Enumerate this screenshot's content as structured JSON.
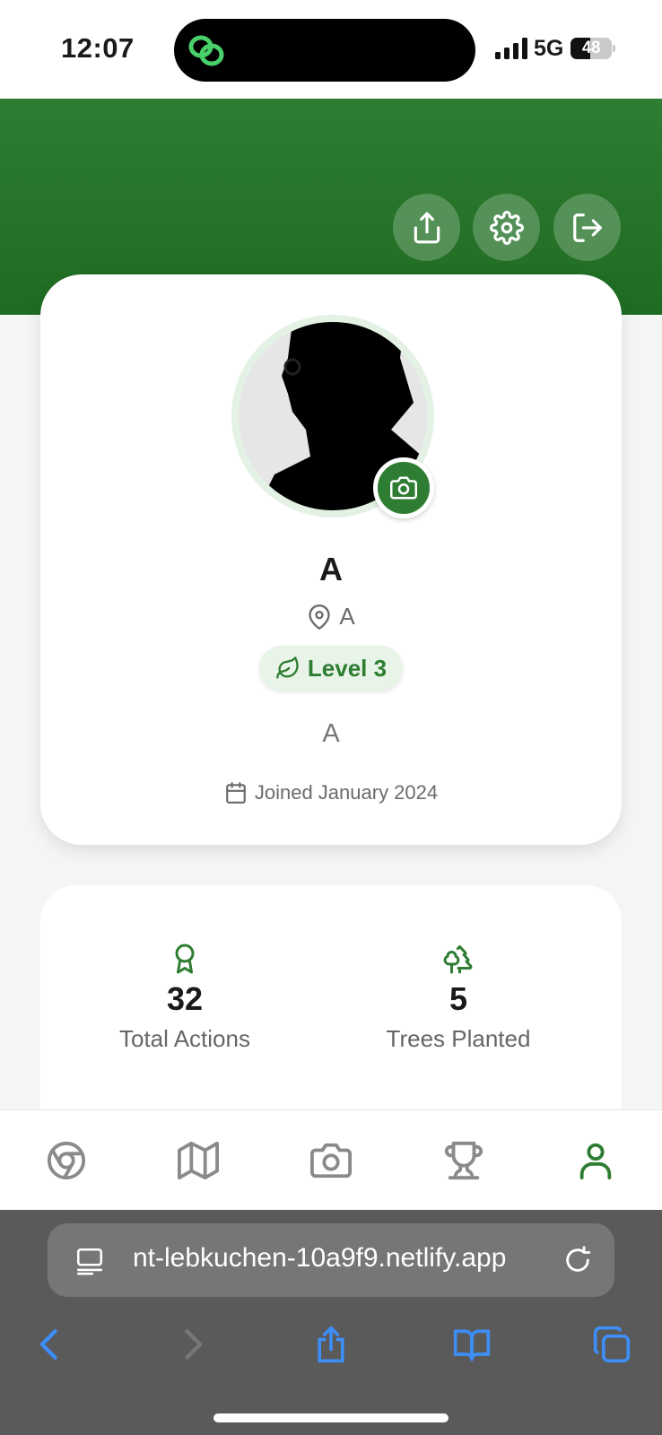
{
  "status_bar": {
    "time": "12:07",
    "network": "5G",
    "battery": "48",
    "battery_level": 0.48
  },
  "header": {
    "actions": [
      {
        "name": "share",
        "icon": "share-icon"
      },
      {
        "name": "settings",
        "icon": "gear-icon"
      },
      {
        "name": "logout",
        "icon": "logout-icon"
      }
    ]
  },
  "profile": {
    "name": "A",
    "location": "A",
    "level": "Level 3",
    "bio": "A",
    "joined": "Joined January 2024"
  },
  "stats": [
    {
      "icon": "award-icon",
      "value": "32",
      "label": "Total Actions"
    },
    {
      "icon": "trees-icon",
      "value": "5",
      "label": "Trees Planted"
    }
  ],
  "nav": {
    "items": [
      "home",
      "map",
      "camera",
      "leaderboard",
      "profile"
    ],
    "active": "profile"
  },
  "browser": {
    "url": "nt-lebkuchen-10a9f9.netlify.app"
  },
  "colors": {
    "brand_green": "#2e7d32",
    "header_green": "#1f6b22",
    "safari_blue": "#3d8ef7",
    "icon_gray": "#8a8a8a"
  }
}
